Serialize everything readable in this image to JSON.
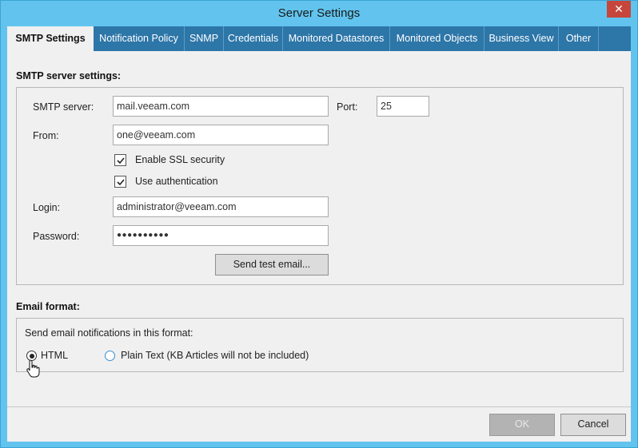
{
  "window": {
    "title": "Server Settings",
    "close_glyph": "✕"
  },
  "tabs": [
    {
      "label": "SMTP Settings",
      "active": true
    },
    {
      "label": "Notification Policy"
    },
    {
      "label": "SNMP"
    },
    {
      "label": "Credentials"
    },
    {
      "label": "Monitored Datastores"
    },
    {
      "label": "Monitored Objects"
    },
    {
      "label": "Business View"
    },
    {
      "label": "Other"
    }
  ],
  "smtp": {
    "section_title": "SMTP server settings:",
    "server_label": "SMTP server:",
    "server_value": "mail.veeam.com",
    "port_label": "Port:",
    "port_value": "25",
    "from_label": "From:",
    "from_value": "one@veeam.com",
    "ssl_label": "Enable SSL security",
    "ssl_checked": true,
    "auth_label": "Use authentication",
    "auth_checked": true,
    "login_label": "Login:",
    "login_value": "administrator@veeam.com",
    "password_label": "Password:",
    "password_value": "●●●●●●●●●●",
    "test_button": "Send test email..."
  },
  "email_format": {
    "section_title": "Email format:",
    "prompt": "Send email notifications in this format:",
    "options": [
      {
        "label": "HTML",
        "selected": true
      },
      {
        "label": "Plain Text (KB Articles will not be included)",
        "selected": false
      }
    ]
  },
  "footer": {
    "ok_label": "OK",
    "cancel_label": "Cancel"
  },
  "colors": {
    "titlebar": "#62c4ee",
    "tabstrip": "#2d76a8",
    "close": "#c7463b"
  }
}
